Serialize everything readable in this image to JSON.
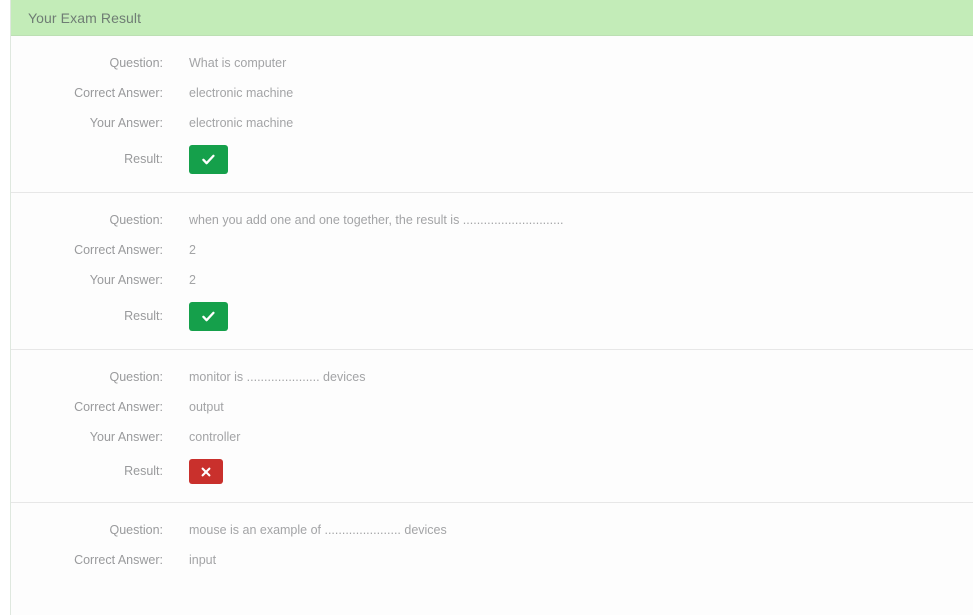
{
  "panel": {
    "title": "Your Exam Result"
  },
  "labels": {
    "question": "Question:",
    "correct_answer": "Correct Answer:",
    "your_answer": "Your Answer:",
    "result": "Result:"
  },
  "icons": {
    "correct": "check-icon",
    "wrong": "cross-icon"
  },
  "colors": {
    "header_bg": "#c3ecb8",
    "correct_badge": "#15a04b",
    "wrong_badge": "#c9302c",
    "text": "#a3a4a6",
    "label_text": "#999a9c"
  },
  "questions": [
    {
      "question": "What is computer",
      "correct_answer": "electronic machine",
      "your_answer": "electronic machine",
      "result": "correct"
    },
    {
      "question": "when you add one and one together, the result is .............................",
      "correct_answer": "2",
      "your_answer": "2",
      "result": "correct"
    },
    {
      "question": "monitor is ..................... devices",
      "correct_answer": "output",
      "your_answer": "controller",
      "result": "wrong"
    },
    {
      "question": "mouse is an example of ...................... devices",
      "correct_answer": "input",
      "your_answer": "",
      "result": ""
    }
  ]
}
